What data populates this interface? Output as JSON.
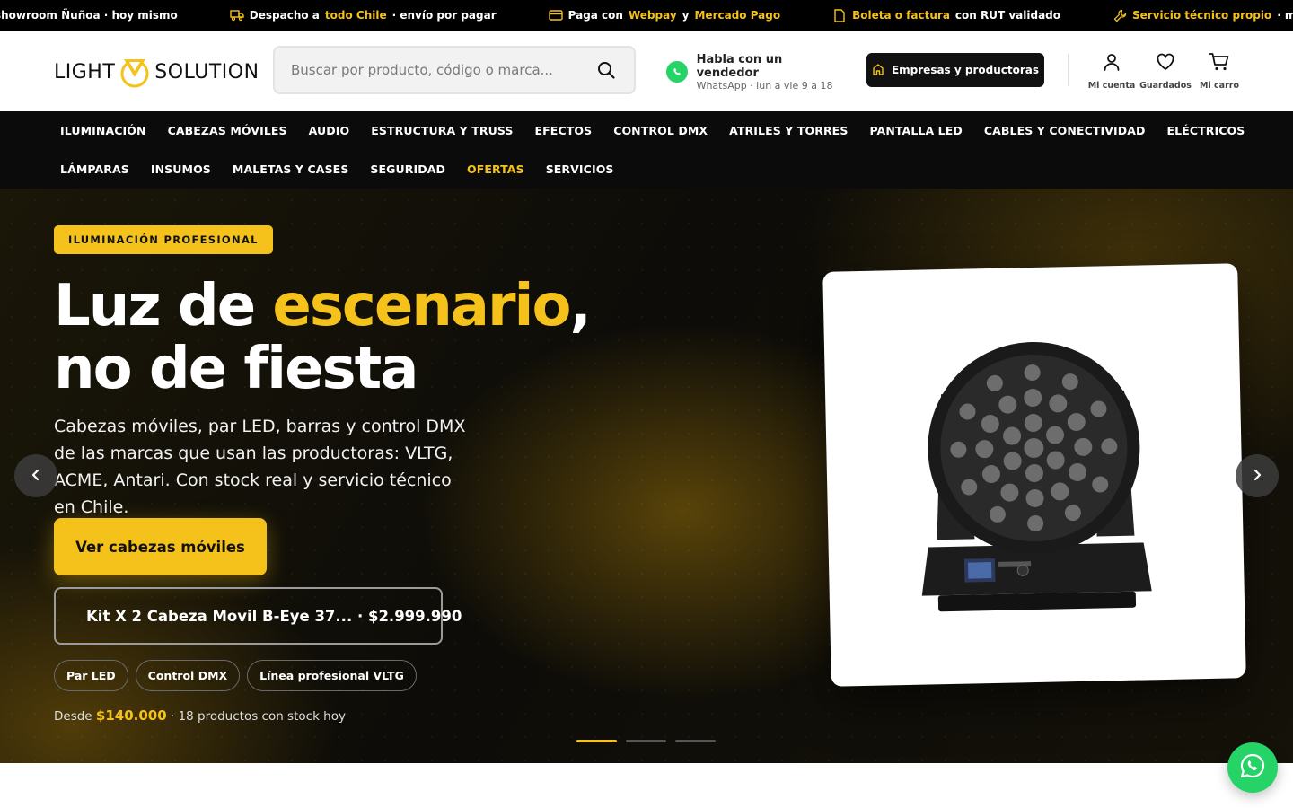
{
  "announcement": {
    "item1": {
      "text": "showroom Ñuñoa · hoy mismo"
    },
    "item2": {
      "pre": "Despacho a",
      "highlight": "todo Chile",
      "post": "· envío por pagar",
      "icon": "truck-icon"
    },
    "item3": {
      "pre": "Paga con",
      "highlight1": "Webpay",
      "mid": "y",
      "highlight2": "Mercado Pago",
      "icon": "credit-card-icon"
    },
    "item4": {
      "highlight": "Boleta o factura",
      "post": "con RUT validado",
      "icon": "document-icon"
    },
    "item5": {
      "highlight": "Servicio técnico propio",
      "post": "· más de",
      "icon": "wrench-icon"
    }
  },
  "header": {
    "logo": {
      "left": "LIGHT",
      "right": "SOLUTION"
    },
    "search": {
      "placeholder": "Buscar por producto, código o marca..."
    },
    "whatsapp": {
      "title": "Habla con un vendedor",
      "subtitle": "WhatsApp · lun a vie 9 a 18"
    },
    "business_button": "Empresas y productoras",
    "actions": [
      {
        "label": "Mi cuenta",
        "icon": "user-icon"
      },
      {
        "label": "Guardados",
        "icon": "heart-icon"
      },
      {
        "label": "Mi carro",
        "icon": "cart-icon"
      }
    ]
  },
  "nav": {
    "row1": [
      "ILUMINACIÓN",
      "CABEZAS MÓVILES",
      "AUDIO",
      "ESTRUCTURA Y TRUSS",
      "EFECTOS",
      "CONTROL DMX",
      "ATRILES Y TORRES",
      "PANTALLA LED",
      "CABLES Y CONECTIVIDAD",
      "ELÉCTRICOS"
    ],
    "row2": [
      "LÁMPARAS",
      "INSUMOS",
      "MALETAS Y CASES",
      "SEGURIDAD",
      "OFERTAS",
      "SERVICIOS"
    ]
  },
  "hero": {
    "badge": "ILUMINACIÓN PROFESIONAL",
    "headline": {
      "part1": "Luz de ",
      "accent": "escenario",
      "part2": ",",
      "line2": "no de fiesta"
    },
    "subtext": "Cabezas móviles, par LED, barras y control DMX de las marcas que usan las productoras: VLTG, ACME, Antari. Con stock real y servicio técnico en Chile.",
    "cta": "Ver cabezas móviles",
    "product_button": "Kit X 2 Cabeza Movil B-Eye 37... · $2.999.990",
    "chips": [
      "Par LED",
      "Control DMX",
      "Línea profesional VLTG"
    ],
    "price_line": {
      "pre": "Desde",
      "price": "$140.000",
      "post": "· 18 productos con stock hoy"
    },
    "slides": {
      "count": 3,
      "active": 1
    }
  },
  "colors": {
    "accent": "#f5c21b",
    "whatsapp": "#25d366",
    "dark": "#0b0b0b"
  }
}
